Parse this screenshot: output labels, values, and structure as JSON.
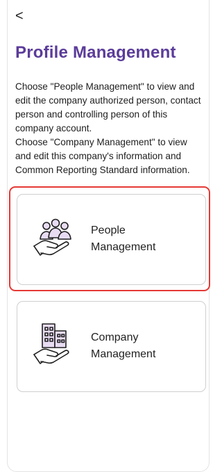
{
  "header": {
    "back_icon": "chevron-left-icon",
    "back_glyph": "<",
    "title": "Profile Management"
  },
  "description": [
    "Choose \"People Management\" to view and edit the company authorized person, contact person and controlling person of this company account.",
    "Choose \"Company Management\" to view and edit this company's information and Common Reporting Standard information."
  ],
  "cards": [
    {
      "icon": "people-in-hand-icon",
      "line1": "People",
      "line2": "Management",
      "highlighted": true
    },
    {
      "icon": "buildings-in-hand-icon",
      "line1": "Company",
      "line2": "Management",
      "highlighted": false
    }
  ],
  "colors": {
    "title": "#5b3c9a",
    "icon_fill": "#e8dcf3",
    "icon_stroke": "#1f1f1f",
    "highlight": "#e53935"
  }
}
